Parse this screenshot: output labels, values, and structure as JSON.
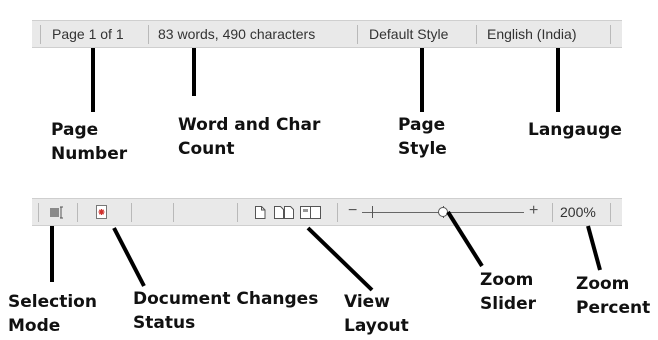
{
  "top_statusbar": {
    "page_number": "Page 1 of 1",
    "word_count": "83 words, 490 characters",
    "page_style": "Default Style",
    "language": "English (India)"
  },
  "top_labels": {
    "page_number": [
      "Page",
      "Number"
    ],
    "word_count": [
      "Word and Char",
      "Count"
    ],
    "page_style": [
      "Page",
      "Style"
    ],
    "language": [
      "Langauge"
    ]
  },
  "bottom_statusbar": {
    "selection_mode_icon": "selection-mode-icon",
    "document_changes_icon": "document-modified-icon",
    "view_layout_icons": [
      "single-page-view-icon",
      "multi-page-view-icon",
      "book-view-icon"
    ],
    "zoom_minus": "−",
    "zoom_plus": "+",
    "zoom_level": 0.5,
    "zoom_percent": "200%"
  },
  "bottom_labels": {
    "selection_mode": [
      "Selection",
      "Mode"
    ],
    "document_changes": [
      "Document Changes",
      "Status"
    ],
    "view_layout": [
      "View",
      "Layout"
    ],
    "zoom_slider": [
      "Zoom",
      "Slider"
    ],
    "zoom_percent": [
      "Zoom",
      "Percent"
    ]
  },
  "colors": {
    "statusbar_bg": "#e9e9e9",
    "modified_icon_red": "#d0312d"
  }
}
